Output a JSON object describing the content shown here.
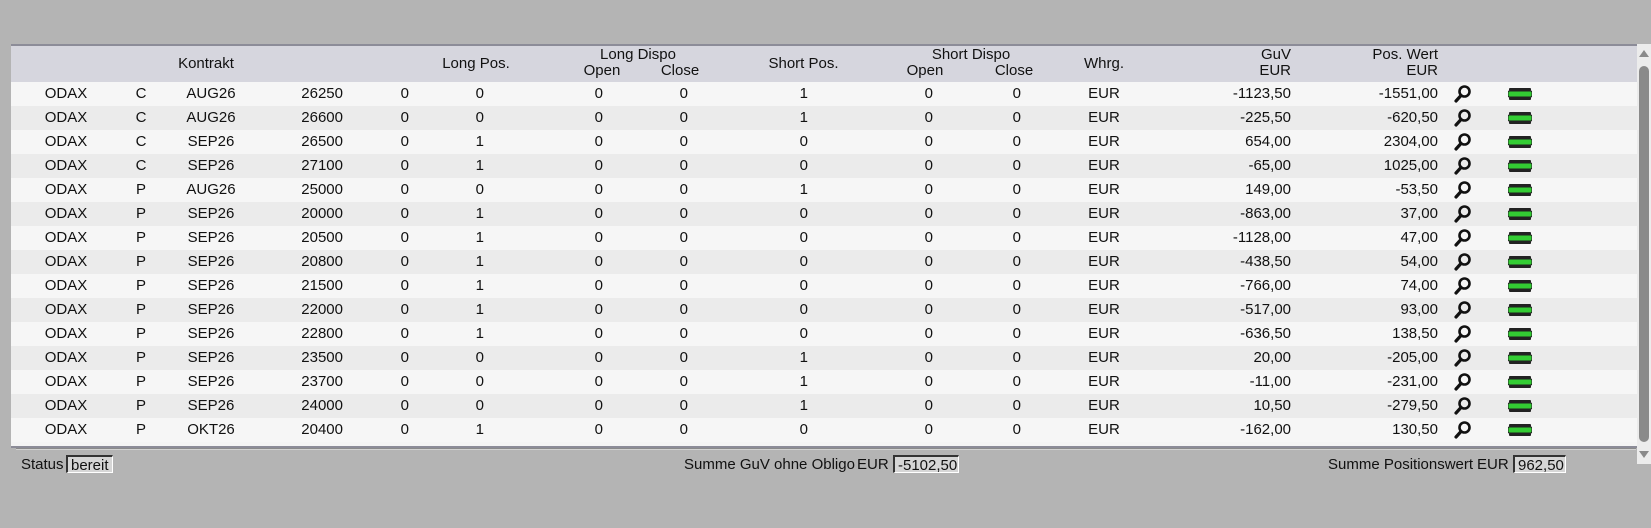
{
  "header": {
    "kontrakt": "Kontrakt",
    "long_pos": "Long Pos.",
    "long_dispo": "Long Dispo",
    "long_open": "Open",
    "long_close": "Close",
    "short_pos": "Short Pos.",
    "short_dispo": "Short Dispo",
    "short_open": "Open",
    "short_close": "Close",
    "whrg": "Whrg.",
    "guv": "GuV",
    "guv_unit": "EUR",
    "pos_wert": "Pos. Wert",
    "pos_wert_unit": "EUR"
  },
  "rows": [
    [
      "ODAX",
      "C",
      "AUG26",
      "26250",
      "0",
      "0",
      "0",
      "0",
      "1",
      "0",
      "0",
      "EUR",
      "-1123,50",
      "-1551,00"
    ],
    [
      "ODAX",
      "C",
      "AUG26",
      "26600",
      "0",
      "0",
      "0",
      "0",
      "1",
      "0",
      "0",
      "EUR",
      "-225,50",
      "-620,50"
    ],
    [
      "ODAX",
      "C",
      "SEP26",
      "26500",
      "0",
      "1",
      "0",
      "0",
      "0",
      "0",
      "0",
      "EUR",
      "654,00",
      "2304,00"
    ],
    [
      "ODAX",
      "C",
      "SEP26",
      "27100",
      "0",
      "1",
      "0",
      "0",
      "0",
      "0",
      "0",
      "EUR",
      "-65,00",
      "1025,00"
    ],
    [
      "ODAX",
      "P",
      "AUG26",
      "25000",
      "0",
      "0",
      "0",
      "0",
      "1",
      "0",
      "0",
      "EUR",
      "149,00",
      "-53,50"
    ],
    [
      "ODAX",
      "P",
      "SEP26",
      "20000",
      "0",
      "1",
      "0",
      "0",
      "0",
      "0",
      "0",
      "EUR",
      "-863,00",
      "37,00"
    ],
    [
      "ODAX",
      "P",
      "SEP26",
      "20500",
      "0",
      "1",
      "0",
      "0",
      "0",
      "0",
      "0",
      "EUR",
      "-1128,00",
      "47,00"
    ],
    [
      "ODAX",
      "P",
      "SEP26",
      "20800",
      "0",
      "1",
      "0",
      "0",
      "0",
      "0",
      "0",
      "EUR",
      "-438,50",
      "54,00"
    ],
    [
      "ODAX",
      "P",
      "SEP26",
      "21500",
      "0",
      "1",
      "0",
      "0",
      "0",
      "0",
      "0",
      "EUR",
      "-766,00",
      "74,00"
    ],
    [
      "ODAX",
      "P",
      "SEP26",
      "22000",
      "0",
      "1",
      "0",
      "0",
      "0",
      "0",
      "0",
      "EUR",
      "-517,00",
      "93,00"
    ],
    [
      "ODAX",
      "P",
      "SEP26",
      "22800",
      "0",
      "1",
      "0",
      "0",
      "0",
      "0",
      "0",
      "EUR",
      "-636,50",
      "138,50"
    ],
    [
      "ODAX",
      "P",
      "SEP26",
      "23500",
      "0",
      "0",
      "0",
      "0",
      "1",
      "0",
      "0",
      "EUR",
      "20,00",
      "-205,00"
    ],
    [
      "ODAX",
      "P",
      "SEP26",
      "23700",
      "0",
      "0",
      "0",
      "0",
      "1",
      "0",
      "0",
      "EUR",
      "-11,00",
      "-231,00"
    ],
    [
      "ODAX",
      "P",
      "SEP26",
      "24000",
      "0",
      "0",
      "0",
      "0",
      "1",
      "0",
      "0",
      "EUR",
      "10,50",
      "-279,50"
    ],
    [
      "ODAX",
      "P",
      "OKT26",
      "20400",
      "0",
      "1",
      "0",
      "0",
      "0",
      "0",
      "0",
      "EUR",
      "-162,00",
      "130,50"
    ]
  ],
  "row_icons": {
    "detail": "magnifier-icon",
    "trade": "green-trade-icon"
  },
  "colors": {
    "trade_icon": "#33cc33",
    "header_bg": "#d6d6de",
    "background": "#b4b4b4"
  },
  "status": {
    "label": "Status",
    "value": "bereit",
    "guv_label": "Summe GuV ohne Obligo",
    "guv_currency": "EUR",
    "guv_value": "-5102,50",
    "pos_label": "Summe Positionswert",
    "pos_currency": "EUR",
    "pos_value": "962,50"
  }
}
